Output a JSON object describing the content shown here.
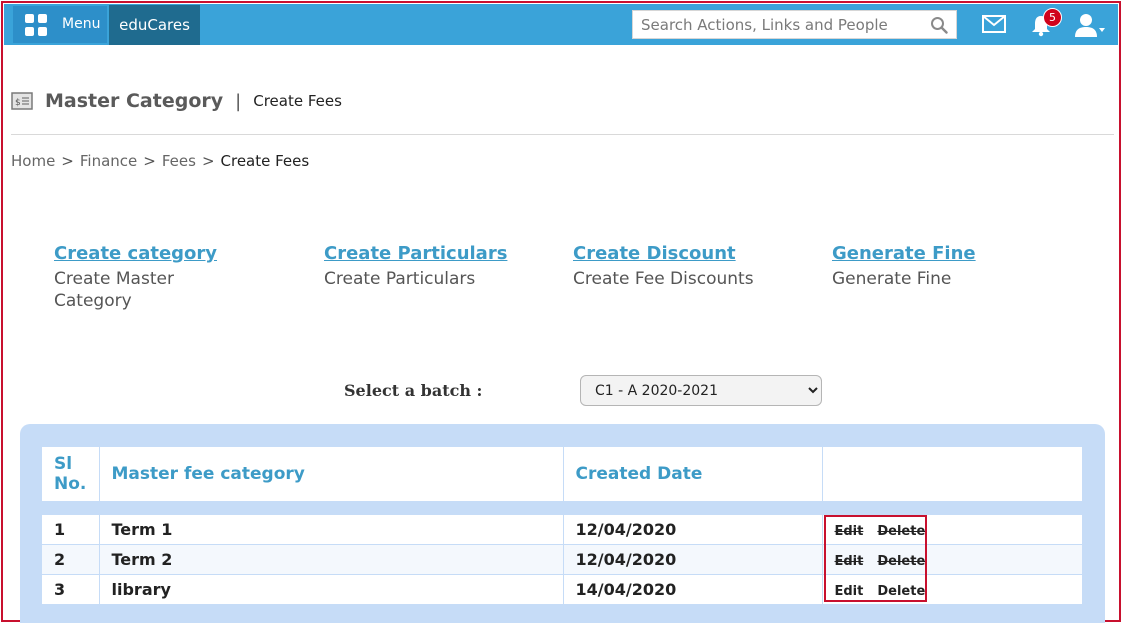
{
  "header": {
    "menu_label": "Menu",
    "brand": "eduCares",
    "search_placeholder": "Search Actions, Links and People",
    "notification_count": "5",
    "accent_color": "#3aa3d9",
    "icons": [
      "menu-grid-icon",
      "search-icon",
      "mail-icon",
      "bell-icon",
      "user-icon"
    ]
  },
  "page": {
    "title": "Master Category",
    "separator": "|",
    "subtitle": "Create Fees"
  },
  "breadcrumb": {
    "items": [
      "Home",
      "Finance",
      "Fees",
      "Create Fees"
    ],
    "separator": ">"
  },
  "quick_links": [
    {
      "title": "Create category",
      "desc_line1": "Create Master",
      "desc_line2": "Category"
    },
    {
      "title": "Create Particulars",
      "desc_line1": "Create Particulars",
      "desc_line2": ""
    },
    {
      "title": "Create Discount",
      "desc_line1": "Create Fee Discounts",
      "desc_line2": ""
    },
    {
      "title": "Generate Fine",
      "desc_line1": "Generate Fine",
      "desc_line2": ""
    }
  ],
  "batch": {
    "label": "Select a batch :",
    "selected": "C1 - A 2020-2021"
  },
  "table": {
    "headers": [
      "Sl No.",
      "Master fee category",
      "Created Date",
      ""
    ],
    "rows": [
      {
        "sl": "1",
        "category": "Term 1",
        "date": "12/04/2020",
        "edit": "Edit",
        "delete": "Delete"
      },
      {
        "sl": "2",
        "category": "Term 2",
        "date": "12/04/2020",
        "edit": "Edit",
        "delete": "Delete"
      },
      {
        "sl": "3",
        "category": "library",
        "date": "14/04/2020",
        "edit": "Edit",
        "delete": "Delete"
      }
    ]
  }
}
